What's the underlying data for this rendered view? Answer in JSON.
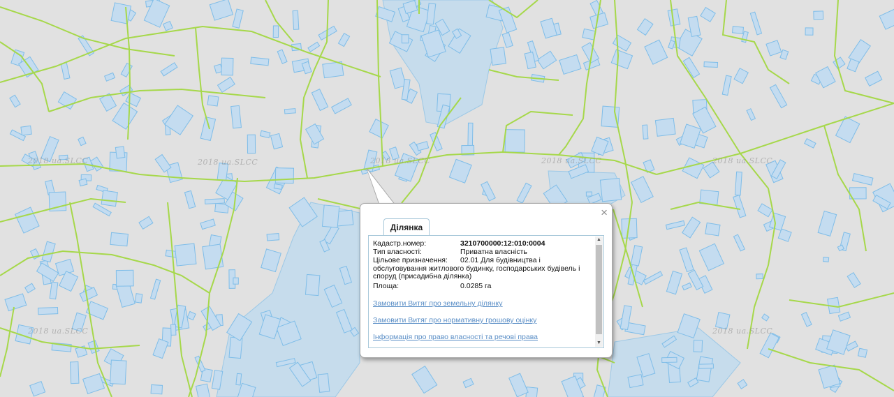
{
  "map": {
    "colors": {
      "background": "#e1e1e1",
      "parcel_fill": "#c4dcf0",
      "parcel_stroke": "#7fbde8",
      "water": "#c6dcec",
      "boundary": "#a6d84a"
    },
    "watermarks": [
      "2018 ua.SLCC",
      "2018 ua.SLCC",
      "2018 ua.SLCC",
      "2018 ua.SLCC",
      "2018 ua.SLCC",
      "2018 ua.SLCC",
      "2018 ua.SLCC"
    ]
  },
  "popup": {
    "close_icon": "×",
    "tab_label": "Ділянка",
    "fields": {
      "cadastral_label": "Кадастр.номер:",
      "cadastral_value": "3210700000:12:010:0004",
      "ownership_label": "Тип власності:",
      "ownership_value": "Приватна власність",
      "purpose_label": "Цільове призначення:",
      "purpose_value_line1": "02.01 Для будівництва і",
      "purpose_value_rest": "обслуговування житлового будинку, господарських будівель і споруд (присадибна ділянка)",
      "area_label": "Площа:",
      "area_value": "0.0285 га"
    },
    "links": {
      "land_extract": "Замовити Витяг про земельну ділянку",
      "valuation_extract": "Замовити Витяг про нормативну грошову оцінку",
      "ownership_info": "Інформація про право власності та речові права"
    }
  }
}
